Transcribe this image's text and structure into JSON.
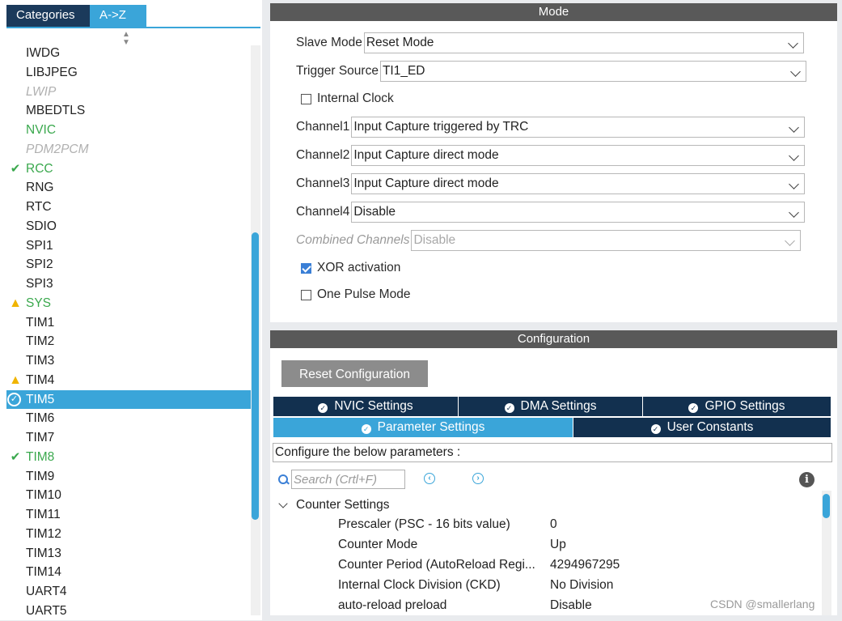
{
  "left_panel": {
    "tabs": {
      "categories": "Categories",
      "a_to_z": "A->Z"
    },
    "items": [
      {
        "label": "IWDG",
        "state": "normal"
      },
      {
        "label": "LIBJPEG",
        "state": "normal"
      },
      {
        "label": "LWIP",
        "state": "disabled"
      },
      {
        "label": "MBEDTLS",
        "state": "normal"
      },
      {
        "label": "NVIC",
        "state": "green"
      },
      {
        "label": "PDM2PCM",
        "state": "disabled"
      },
      {
        "label": "RCC",
        "state": "green",
        "icon": "check-icon"
      },
      {
        "label": "RNG",
        "state": "normal"
      },
      {
        "label": "RTC",
        "state": "normal"
      },
      {
        "label": "SDIO",
        "state": "normal"
      },
      {
        "label": "SPI1",
        "state": "normal"
      },
      {
        "label": "SPI2",
        "state": "normal"
      },
      {
        "label": "SPI3",
        "state": "normal"
      },
      {
        "label": "SYS",
        "state": "green",
        "icon": "warning-icon"
      },
      {
        "label": "TIM1",
        "state": "normal"
      },
      {
        "label": "TIM2",
        "state": "normal"
      },
      {
        "label": "TIM3",
        "state": "normal"
      },
      {
        "label": "TIM4",
        "state": "normal",
        "icon": "warning-icon"
      },
      {
        "label": "TIM5",
        "state": "selected",
        "icon": "check-circle-icon"
      },
      {
        "label": "TIM6",
        "state": "normal"
      },
      {
        "label": "TIM7",
        "state": "normal"
      },
      {
        "label": "TIM8",
        "state": "green",
        "icon": "check-icon"
      },
      {
        "label": "TIM9",
        "state": "normal"
      },
      {
        "label": "TIM10",
        "state": "normal"
      },
      {
        "label": "TIM11",
        "state": "normal"
      },
      {
        "label": "TIM12",
        "state": "normal"
      },
      {
        "label": "TIM13",
        "state": "normal"
      },
      {
        "label": "TIM14",
        "state": "normal"
      },
      {
        "label": "UART4",
        "state": "normal"
      },
      {
        "label": "UART5",
        "state": "normal"
      }
    ]
  },
  "mode": {
    "title": "Mode",
    "slave_mode": {
      "label": "Slave Mode",
      "value": "Reset Mode"
    },
    "trigger_source": {
      "label": "Trigger Source",
      "value": "TI1_ED"
    },
    "internal_clock": {
      "label": "Internal Clock",
      "checked": false
    },
    "channel1": {
      "label": "Channel1",
      "value": "Input Capture triggered by TRC"
    },
    "channel2": {
      "label": "Channel2",
      "value": "Input Capture direct mode"
    },
    "channel3": {
      "label": "Channel3",
      "value": "Input Capture direct mode"
    },
    "channel4": {
      "label": "Channel4",
      "value": "Disable"
    },
    "combined_channels": {
      "label": "Combined Channels",
      "value": "Disable"
    },
    "xor_activation": {
      "label": "XOR activation",
      "checked": true
    },
    "one_pulse_mode": {
      "label": "One Pulse Mode",
      "checked": false
    }
  },
  "configuration": {
    "title": "Configuration",
    "reset_button": "Reset Configuration",
    "tabs": {
      "nvic": "NVIC Settings",
      "dma": "DMA Settings",
      "gpio": "GPIO Settings",
      "parameter": "Parameter Settings",
      "user_constants": "User Constants"
    },
    "hint": "Configure the below parameters :",
    "search_placeholder": "Search (Crtl+F)",
    "group": "Counter Settings",
    "params": [
      {
        "name": "Prescaler (PSC - 16 bits value)",
        "value": "0"
      },
      {
        "name": "Counter Mode",
        "value": "Up"
      },
      {
        "name": "Counter Period (AutoReload Regi...",
        "value": "4294967295"
      },
      {
        "name": "Internal Clock Division (CKD)",
        "value": "No Division"
      },
      {
        "name": "auto-reload preload",
        "value": "Disable"
      }
    ]
  },
  "watermark": "CSDN @smallerlang",
  "colors": {
    "accent": "#3aa5d9",
    "dark_navy": "#12304f",
    "green": "#3aa84d",
    "warning": "#f0b400"
  }
}
